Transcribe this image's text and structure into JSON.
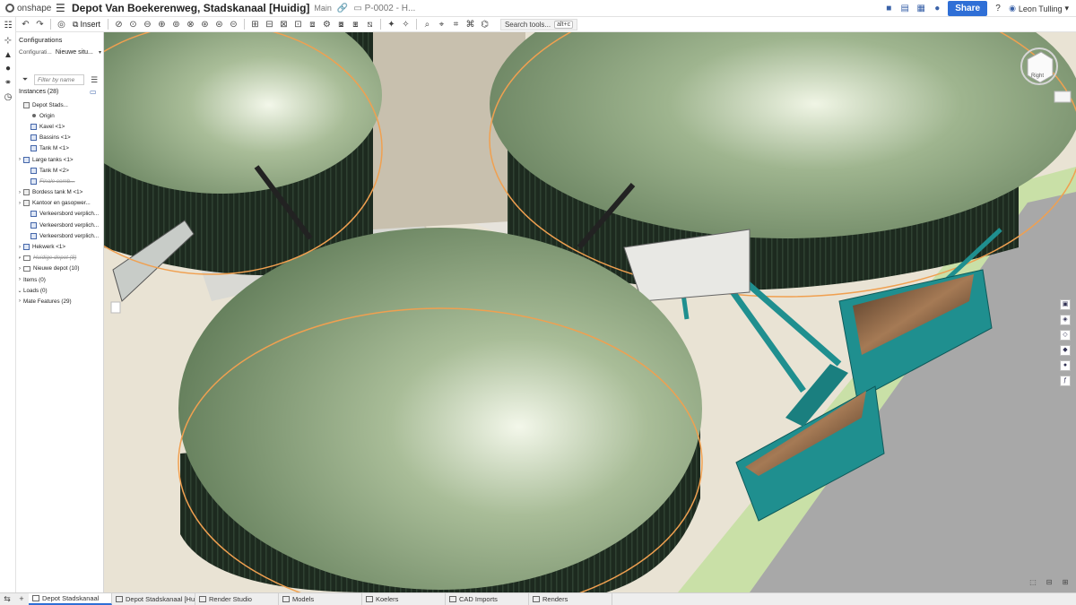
{
  "app": {
    "logo_text": "onshape",
    "document_title": "Depot Van Boekerenweg, Stadskanaal [Huidig]",
    "branch": "Main",
    "folder_path": "P-0002 - H..."
  },
  "topbar": {
    "share_label": "Share",
    "help_label": "?",
    "user_name": "Leon Tulling"
  },
  "toolbar": {
    "insert_label": "Insert",
    "search_tools_label": "Search tools...",
    "search_shortcut": "alt+c"
  },
  "panel": {
    "configurations_title": "Configurations",
    "config_label": "Configurati...",
    "config_value": "Nieuwe situ...",
    "filter_placeholder": "Filter by name",
    "instances_title": "Instances (28)",
    "tree": [
      {
        "label": "Depot Stads...",
        "type": "asm",
        "caret": "",
        "indent": 0
      },
      {
        "label": "Origin",
        "type": "origin",
        "caret": "",
        "indent": 1
      },
      {
        "label": "Kavel <1>",
        "type": "part",
        "caret": "",
        "indent": 1
      },
      {
        "label": "Bassins <1>",
        "type": "part",
        "caret": "",
        "indent": 1
      },
      {
        "label": "Tank M <1>",
        "type": "part",
        "caret": "",
        "indent": 1
      },
      {
        "label": "Large tanks <1>",
        "type": "part",
        "caret": "›",
        "indent": 0
      },
      {
        "label": "Tank M <2>",
        "type": "part",
        "caret": "",
        "indent": 1
      },
      {
        "label": "Finale comb...",
        "type": "part",
        "caret": "",
        "indent": 1,
        "suppressed": true
      },
      {
        "label": "Bordess tank M <1>",
        "type": "asm",
        "caret": "›",
        "indent": 0
      },
      {
        "label": "Kantoor en gasopwer...",
        "type": "asm",
        "caret": "›",
        "indent": 0
      },
      {
        "label": "Verkeersbord verplich...",
        "type": "part",
        "caret": "",
        "indent": 1
      },
      {
        "label": "Verkeersbord verplich...",
        "type": "part",
        "caret": "",
        "indent": 1
      },
      {
        "label": "Verkeersbord verplich...",
        "type": "part",
        "caret": "",
        "indent": 1
      },
      {
        "label": "Hekwerk <1>",
        "type": "part",
        "caret": "›",
        "indent": 0
      },
      {
        "label": "Huidige depot (8)",
        "type": "folder",
        "caret": "›",
        "indent": 0,
        "suppressed": true
      },
      {
        "label": "Nieuwe depot (10)",
        "type": "folder",
        "caret": "›",
        "indent": 0
      },
      {
        "label": "Items (0)",
        "type": "none",
        "caret": "›",
        "indent": 0
      },
      {
        "label": "Loads (0)",
        "type": "none",
        "caret": "⌄",
        "indent": 0
      },
      {
        "label": "Mate Features (29)",
        "type": "none",
        "caret": "›",
        "indent": 0
      }
    ]
  },
  "tabs": [
    {
      "label": "Depot Stadskanaal",
      "active": true
    },
    {
      "label": "Depot Stadskanaal [Hui...",
      "active": false
    },
    {
      "label": "Render Studio",
      "active": false
    },
    {
      "label": "Models",
      "active": false
    },
    {
      "label": "Koelers",
      "active": false
    },
    {
      "label": "CAD Imports",
      "active": false
    },
    {
      "label": "Renders",
      "active": false
    }
  ],
  "viewcube": {
    "face_label": "Right"
  },
  "colors": {
    "accent": "#2f6fd6",
    "tank_roof": "#6e8a64",
    "tank_wall": "#1e2a20",
    "pipes": "#1f8f8f",
    "ground": "#e9e3d4",
    "selection_outline": "#f0a050"
  }
}
